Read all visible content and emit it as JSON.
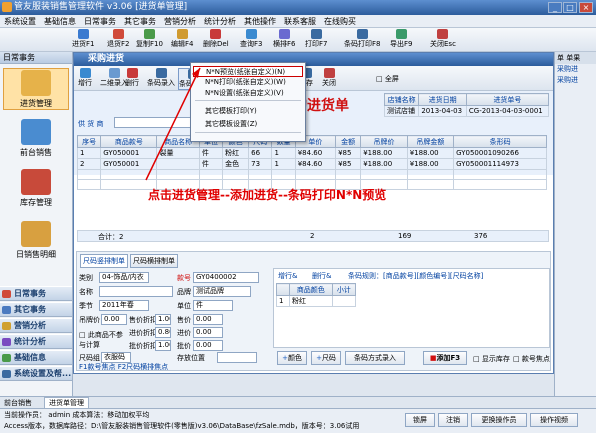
{
  "app": {
    "title": "管友服装销售管理软件 v3.06 [进货单管理]"
  },
  "menubar": [
    "系统设置",
    "基础信息",
    "日常事务",
    "其它事务",
    "营销分析",
    "统计分析",
    "其他操作",
    "联系客服",
    "在线购买"
  ],
  "toolbar": [
    "进货F1",
    "退货F2",
    "复制F10",
    "编辑F4",
    "删除Del",
    "查询F3",
    "横排F6",
    "打印F7",
    "条码打印F8",
    "导出F9",
    "关闭Esc"
  ],
  "sidebar": {
    "header": "日常事务",
    "modules": [
      "进货管理",
      "前台销售",
      "库存管理",
      "日销售明细"
    ],
    "groups": [
      "日常事务",
      "其它事务",
      "营销分析",
      "统计分析",
      "基础信息",
      "系统设置及帮..."
    ]
  },
  "window": {
    "title": "采购进货",
    "toolbar": [
      "增行",
      "二维录入",
      "删行",
      "条码录入",
      "条码打印",
      "导入",
      "存为草稿",
      "恢复草稿",
      "保存",
      "关闭"
    ],
    "fullscreen": "全屏"
  },
  "form": {
    "heading": "采购进货单",
    "store_label": "店铺名称",
    "store_value": "测试店铺",
    "date_label": "进货日期",
    "date_value": "2013-04-03",
    "no_label": "进货单号",
    "no_value": "CG-2013-04-03-0001",
    "supplier_label": "供 货 商"
  },
  "context_menu": {
    "items": [
      "N*N预览(纸张自定义)(N)",
      "N*N打印(纸张自定义)(W)",
      "N*N设置(纸张自定义)(V)",
      "其它模板打印(Y)",
      "其它模板设置(Z)"
    ]
  },
  "grid": {
    "headers": [
      "序号",
      "商品款号",
      "商品名称",
      "单位",
      "颜色",
      "尺码",
      "数量",
      "单价",
      "金额",
      "吊牌价",
      "吊牌金额",
      "条形码"
    ],
    "rows": [
      [
        "1",
        "GY050001",
        "裂量",
        "件",
        "粉红",
        "66",
        "1",
        "¥84.60",
        "¥85",
        "¥188.00",
        "¥188.00",
        "GY050001090266"
      ],
      [
        "2",
        "GY050001",
        "",
        "件",
        "金色",
        "73",
        "1",
        "¥84.60",
        "¥85",
        "¥188.00",
        "¥188.00",
        "GY050001114973"
      ]
    ],
    "footer": {
      "label": "合计：2",
      "qty": "2",
      "amount": "169",
      "tag_amount": "376"
    }
  },
  "annotation": "点击进货管理--添加进货--条码打印N*N预览",
  "lower": {
    "tabs": [
      "尺码竖排制单",
      "尺码横排制单"
    ],
    "type_label": "类别",
    "type_value": "04-饰品/内衣",
    "code_label": "款号",
    "code_value": "GY0400002",
    "name_label": "名称",
    "brand_label": "品牌",
    "brand_value": "测试品牌",
    "season_label": "季节",
    "season_value": "2011年春",
    "unit_label": "单位",
    "unit_value": "件",
    "tag_label": "吊牌价",
    "tag_value": "0.00",
    "sale_label": "售价折扣",
    "sale_value": "1.00",
    "price_label": "售价",
    "price_value": "0.00",
    "chk_label": "此商品不参与计算",
    "in_label": "进价折扣",
    "in_value": "0.80",
    "inprice_label": "进价",
    "inprice_value": "0.00",
    "wholesale_label": "批价折扣",
    "wholesale_value": "1.00",
    "wprice_label": "批价",
    "wprice_value": "0.00",
    "size_label": "尺码组",
    "size_value": "衣服码",
    "store_label": "存放位置",
    "hint": "F1款号焦点 F2尺码横排焦点",
    "add_row": "增行&",
    "del_row": "删行&",
    "rule": "条码规则：[商品款号][颜色编号][尺码名称]",
    "sub_headers": [
      "商品颜色",
      "小计"
    ],
    "sub_row": [
      "1",
      "粉红"
    ],
    "color_btn": "颜色",
    "size_btn": "尺码",
    "barcode_btn": "条码方式录入",
    "add_btn": "添加F3",
    "show_stock": "显示库存",
    "focus_code": "款号焦点"
  },
  "tabs": [
    "前台销售",
    "进货单管理"
  ],
  "status": {
    "operator": "当前操作员： admin  成本算法：移动加权平均",
    "path": "Access版本，数据库路径：D:\\管友服装销售管理软件(零售版)v3.06\\DataBase\\fzSale.mdb，版本号：3.06试用",
    "buttons": [
      "锁屏",
      "注销",
      "更换操作员",
      "操作视频"
    ]
  },
  "right_panel": {
    "head": [
      "单",
      "单果"
    ],
    "items": [
      "采购进",
      "采购进"
    ]
  }
}
